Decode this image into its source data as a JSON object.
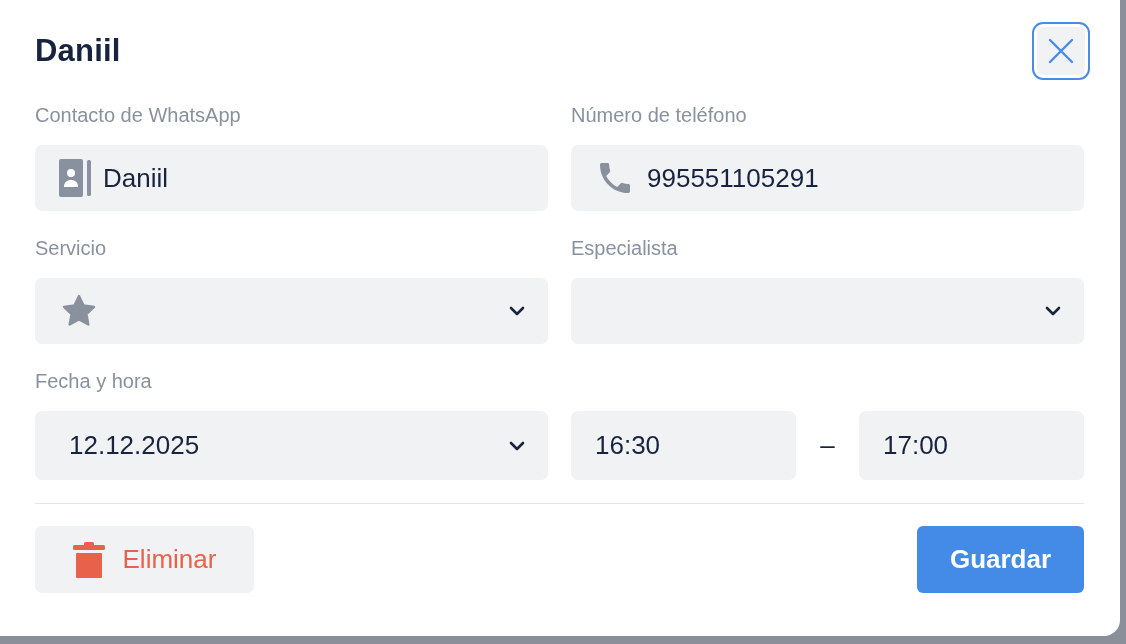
{
  "dialog": {
    "title": "Daniil",
    "rows": [
      {
        "fields": [
          {
            "label": "Contacto de WhatsApp",
            "kind": "contact",
            "value": "Daniil"
          },
          {
            "label": "Número de teléfono",
            "kind": "phone",
            "value": "995551105291"
          }
        ]
      },
      {
        "fields": [
          {
            "label": "Servicio",
            "kind": "service-select"
          },
          {
            "label": "Especialista",
            "kind": "select"
          }
        ]
      }
    ],
    "datetime": {
      "label": "Fecha y hora",
      "date": "12.12.2025",
      "start": "16:30",
      "separator": "–",
      "end": "17:00"
    },
    "buttons": [
      {
        "label": "Eliminar",
        "kind": "delete"
      },
      {
        "label": "Guardar",
        "kind": "save"
      }
    ]
  }
}
